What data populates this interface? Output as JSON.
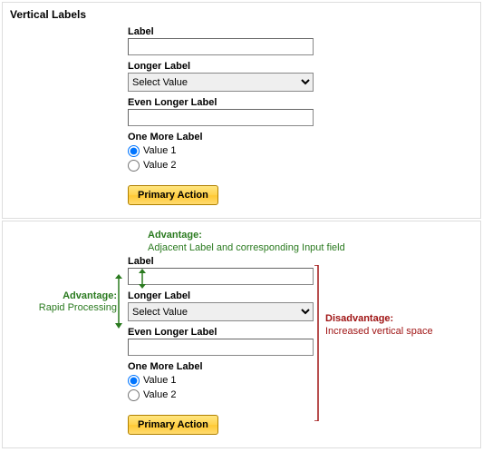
{
  "title": "Vertical Labels",
  "form": {
    "label1": "Label",
    "input1_value": "",
    "label2": "Longer Label",
    "select_value": "Select Value",
    "label3": "Even Longer Label",
    "input3_value": "",
    "label4": "One More Label",
    "radio1": "Value 1",
    "radio2": "Value 2",
    "primary": "Primary Action"
  },
  "annotations": {
    "adv_top_title": "Advantage:",
    "adv_top_text": "Adjacent Label and corresponding Input field",
    "adv_left_title": "Advantage:",
    "adv_left_text": "Rapid Processing",
    "dis_title": "Disadvantage:",
    "dis_text": "Increased vertical space"
  },
  "colors": {
    "advantage": "#2a7a1f",
    "disadvantage": "#a01515"
  }
}
